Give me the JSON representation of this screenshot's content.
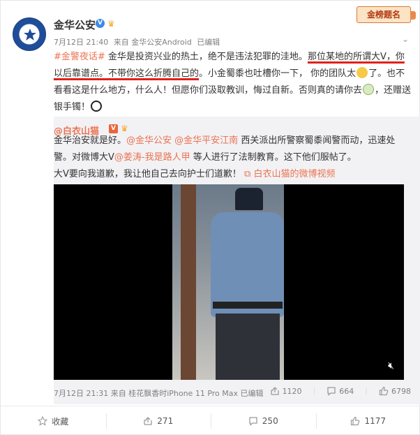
{
  "post": {
    "author": "金华公安",
    "time": "7月12日 21:40",
    "source": "来自 金华公安Android",
    "edited": "已编辑",
    "stamp": "金榜题名",
    "text": {
      "hashtag": "#金警夜话#",
      "p1": " 金华是投资兴业的热土，绝不是违法犯罪的洼地。",
      "p2": "那位某地的所谓大V，你以后靠谱点。不带你这么折腾自己的",
      "p3": "。小金蜀黍也吐槽你一下， 你的团队太",
      "p4": "了。也不看看这是什么地方，什么人！但愿你们汲取教训，悔过自新。否则真的请你去",
      "p5": "，还赠送银手镯！"
    }
  },
  "repost": {
    "author": "@白衣山猫",
    "text": {
      "p1": "金华治安就是好。",
      "m1": "@金华公安",
      "m2": "@金华平安江南",
      "p2": " 西关派出所警察蜀黍闻警而动，迅速处警。对微博大V",
      "m3": "@姜涛-我是路人甲",
      "p3": " 等人进行了法制教育。这下他们服帖了。",
      "p4": "大V要向我道歉，我让他自己去向护士们道歉！",
      "video_link": "白衣山猫的微博视频"
    },
    "time": "7月12日 21:31",
    "source": "来自 桂花飘香时iPhone 11 Pro Max",
    "edited": "已编辑",
    "shares": "1120",
    "comments": "664",
    "likes": "6798"
  },
  "actions": {
    "favorite": "收藏",
    "share": "271",
    "comment": "250",
    "like": "1177"
  },
  "icons": [
    "police-avatar-icon",
    "verified-v-icon",
    "crown-badge-icon",
    "chevron-down-icon",
    "share-icon",
    "comment-icon",
    "like-icon",
    "star-icon",
    "mute-icon",
    "video-link-icon"
  ],
  "colors": {
    "link": "#eb7350",
    "underline": "#e0211b",
    "repost_bg": "#f2f2f5"
  }
}
